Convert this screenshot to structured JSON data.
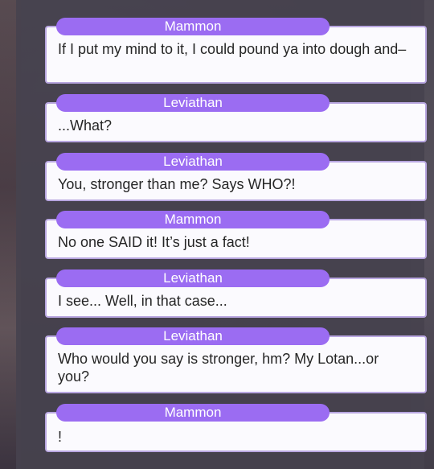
{
  "messages": [
    {
      "speaker": "Mammon",
      "text": "If I put my mind to it, I could pound ya into dough and–"
    },
    {
      "speaker": "Leviathan",
      "text": "...What?"
    },
    {
      "speaker": "Leviathan",
      "text": "You, stronger than me? Says WHO?!"
    },
    {
      "speaker": "Mammon",
      "text": "No one SAID it! It’s just a fact!"
    },
    {
      "speaker": "Leviathan",
      "text": "I see... Well, in that case..."
    },
    {
      "speaker": "Leviathan",
      "text": "Who would you say is stronger, hm? My Lotan...or you?"
    },
    {
      "speaker": "Mammon",
      "text": "!"
    }
  ],
  "colors": {
    "speaker_tag": "#9b6cf2",
    "bubble_bg": "#fbfafe",
    "bubble_border": "#b8a6e0",
    "panel_bg": "#46424e"
  }
}
